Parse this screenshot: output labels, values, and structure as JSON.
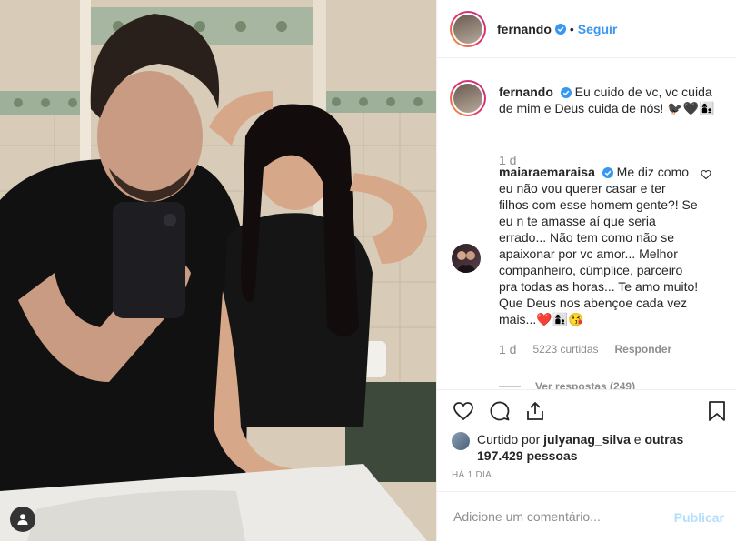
{
  "post": {
    "author": "fernando",
    "follow_label": "Seguir",
    "dot": "•"
  },
  "caption": {
    "username": "fernando",
    "text": "Eu cuido de vc, vc cuida de mim e Deus cuida de nós! 🐦‍⬛🖤👩‍👦",
    "time": "1 d"
  },
  "comment": {
    "username": "maiaraemaraisa",
    "text": "Me diz como eu não vou querer casar e ter filhos com esse homem gente?! Se eu n te amasse aí que seria errado... Não tem como não se apaixonar por vc amor... Melhor companheiro, cúmplice, parceiro pra todas as horas... Te amo muito! Que Deus nos abençoe cada vez mais...❤️👩‍👦😘",
    "time": "1 d",
    "likes": "5223 curtidas",
    "reply_label": "Responder",
    "view_replies": "Ver respostas (249)"
  },
  "likes": {
    "prefix": "Curtido por",
    "user": "julyanag_silva",
    "and": "e",
    "others": "outras 197.429 pessoas"
  },
  "timestamp": "HÁ 1 DIA",
  "add_comment": {
    "placeholder": "Adicione um comentário...",
    "publish_label": "Publicar"
  },
  "icons": {
    "verified": "verified-badge-icon",
    "heart": "heart-icon",
    "comment": "comment-icon",
    "share": "share-icon",
    "save": "bookmark-icon",
    "user_tag": "user-tag-icon"
  },
  "colors": {
    "accent": "#3897f0",
    "publish_disabled": "#b2dffc",
    "muted": "#8e8e8e"
  }
}
